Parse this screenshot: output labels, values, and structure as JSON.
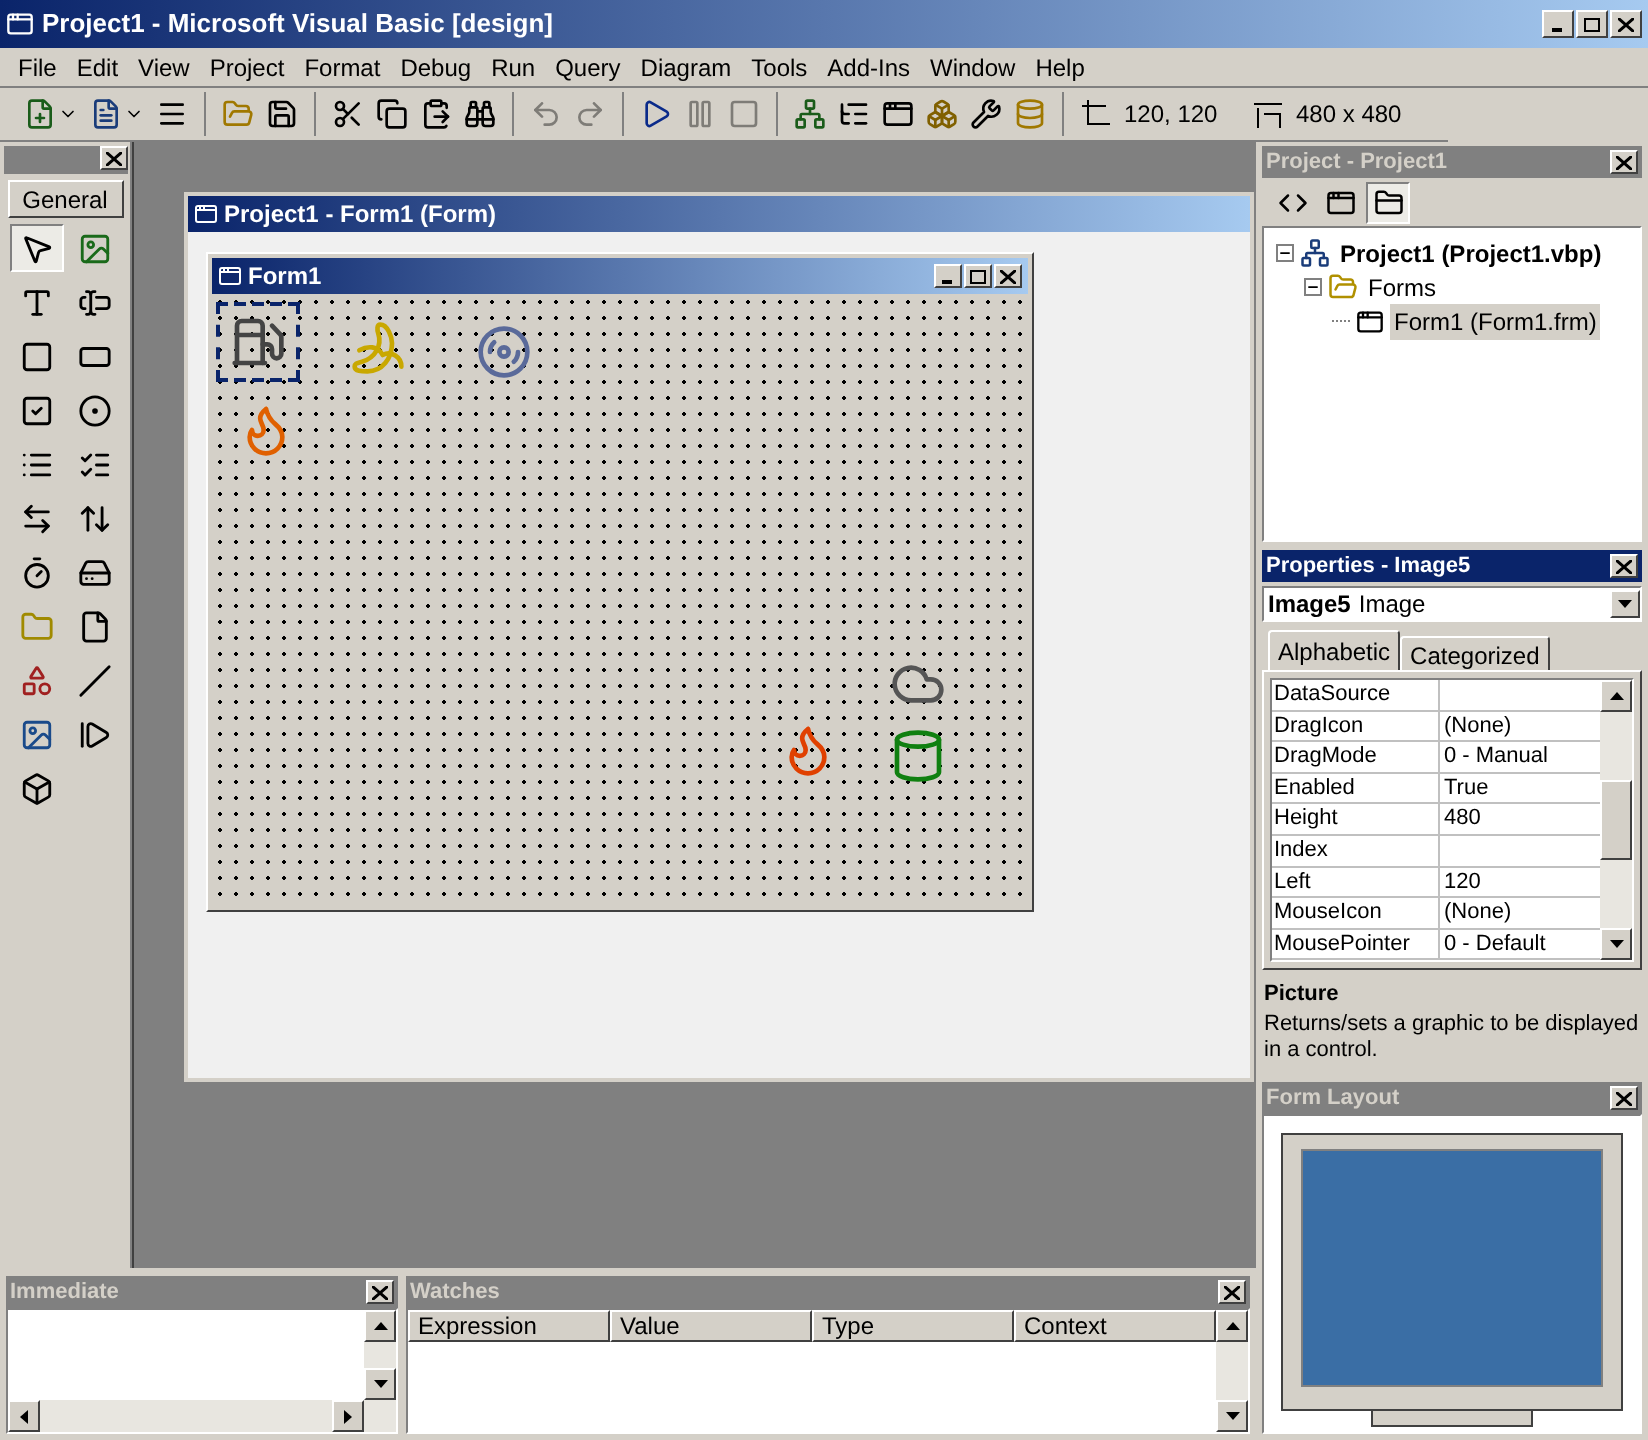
{
  "window": {
    "title": "Project1 - Microsoft Visual Basic [design]"
  },
  "menu": [
    "File",
    "Edit",
    "View",
    "Project",
    "Format",
    "Debug",
    "Run",
    "Query",
    "Diagram",
    "Tools",
    "Add-Ins",
    "Window",
    "Help"
  ],
  "toolbar": {
    "groups": [
      [
        {
          "kind": "add-project",
          "disabled": false
        },
        {
          "kind": "add-form",
          "disabled": false
        },
        {
          "kind": "menu-editor",
          "disabled": false
        }
      ],
      [
        {
          "kind": "open",
          "disabled": false
        },
        {
          "kind": "save",
          "disabled": false
        }
      ],
      [
        {
          "kind": "cut",
          "disabled": false
        },
        {
          "kind": "copy",
          "disabled": false
        },
        {
          "kind": "paste",
          "disabled": false
        },
        {
          "kind": "find",
          "disabled": false
        }
      ],
      [
        {
          "kind": "undo",
          "disabled": true
        },
        {
          "kind": "redo",
          "disabled": true
        }
      ],
      [
        {
          "kind": "start",
          "disabled": false
        },
        {
          "kind": "break",
          "disabled": true
        },
        {
          "kind": "end",
          "disabled": true
        }
      ],
      [
        {
          "kind": "project-explorer",
          "disabled": false
        },
        {
          "kind": "properties",
          "disabled": false
        },
        {
          "kind": "form-layout",
          "disabled": false
        },
        {
          "kind": "object-browser",
          "disabled": false
        },
        {
          "kind": "toolbox",
          "disabled": false
        },
        {
          "kind": "data-view",
          "disabled": false
        }
      ]
    ],
    "position": "120, 120",
    "size": "480 x 480"
  },
  "toolbox": {
    "tab": "General",
    "tools": [
      {
        "kind": "pointer",
        "selected": true
      },
      {
        "kind": "picturebox",
        "selected": false
      },
      {
        "kind": "label",
        "selected": false
      },
      {
        "kind": "textbox",
        "selected": false
      },
      {
        "kind": "frame",
        "selected": false
      },
      {
        "kind": "commandbutton",
        "selected": false
      },
      {
        "kind": "checkbox",
        "selected": false
      },
      {
        "kind": "option",
        "selected": false
      },
      {
        "kind": "combobox",
        "selected": false
      },
      {
        "kind": "listbox",
        "selected": false
      },
      {
        "kind": "hscroll",
        "selected": false
      },
      {
        "kind": "vscroll",
        "selected": false
      },
      {
        "kind": "timer",
        "selected": false
      },
      {
        "kind": "drivelist",
        "selected": false
      },
      {
        "kind": "dirlist",
        "selected": false
      },
      {
        "kind": "filelist",
        "selected": false
      },
      {
        "kind": "shape",
        "selected": false
      },
      {
        "kind": "line",
        "selected": false
      },
      {
        "kind": "image",
        "selected": false
      },
      {
        "kind": "data",
        "selected": false
      },
      {
        "kind": "ole",
        "selected": false
      }
    ]
  },
  "designer": {
    "title": "Project1 - Form1 (Form)",
    "form": {
      "title": "Form1",
      "images": [
        {
          "kind": "fuel-pump",
          "selected": true
        },
        {
          "kind": "banana",
          "selected": false
        },
        {
          "kind": "disc",
          "selected": false
        },
        {
          "kind": "match",
          "selected": false
        },
        {
          "kind": "cloud",
          "selected": false
        },
        {
          "kind": "burning-barrel",
          "selected": false
        },
        {
          "kind": "barrel",
          "selected": false
        }
      ]
    }
  },
  "project": {
    "title": "Project - Project1",
    "active": false,
    "buttons": [
      {
        "kind": "view-code",
        "pressed": false
      },
      {
        "kind": "view-object",
        "pressed": false
      },
      {
        "kind": "toggle-folders",
        "pressed": true
      }
    ],
    "tree": [
      {
        "label": "Project1 (Project1.vbp)",
        "kind": "project",
        "expanded": true,
        "selected": false,
        "children": [
          {
            "label": "Forms",
            "kind": "folder",
            "expanded": true,
            "selected": false,
            "children": [
              {
                "label": "Form1 (Form1.frm)",
                "kind": "form",
                "selected": true
              }
            ]
          }
        ]
      }
    ]
  },
  "properties": {
    "title": "Properties - Image5",
    "active": true,
    "object": "Image5",
    "object_type": "Image",
    "tabs": [
      {
        "label": "Alphabetic",
        "selected": true
      },
      {
        "label": "Categorized",
        "selected": false
      }
    ],
    "rows": [
      {
        "name": "DataSource",
        "value": ""
      },
      {
        "name": "DragIcon",
        "value": "(None)"
      },
      {
        "name": "DragMode",
        "value": "0 - Manual"
      },
      {
        "name": "Enabled",
        "value": "True"
      },
      {
        "name": "Height",
        "value": "480"
      },
      {
        "name": "Index",
        "value": ""
      },
      {
        "name": "Left",
        "value": "120"
      },
      {
        "name": "MouseIcon",
        "value": "(None)"
      },
      {
        "name": "MousePointer",
        "value": "0 - Default"
      }
    ],
    "description": {
      "title": "Picture",
      "text": "Returns/sets a graphic to be displayed in a control."
    }
  },
  "form_layout": {
    "title": "Form Layout",
    "active": false
  },
  "immediate": {
    "title": "Immediate",
    "active": false
  },
  "watches": {
    "title": "Watches",
    "active": false,
    "columns": [
      "Expression",
      "Value",
      "Type",
      "Context"
    ]
  }
}
